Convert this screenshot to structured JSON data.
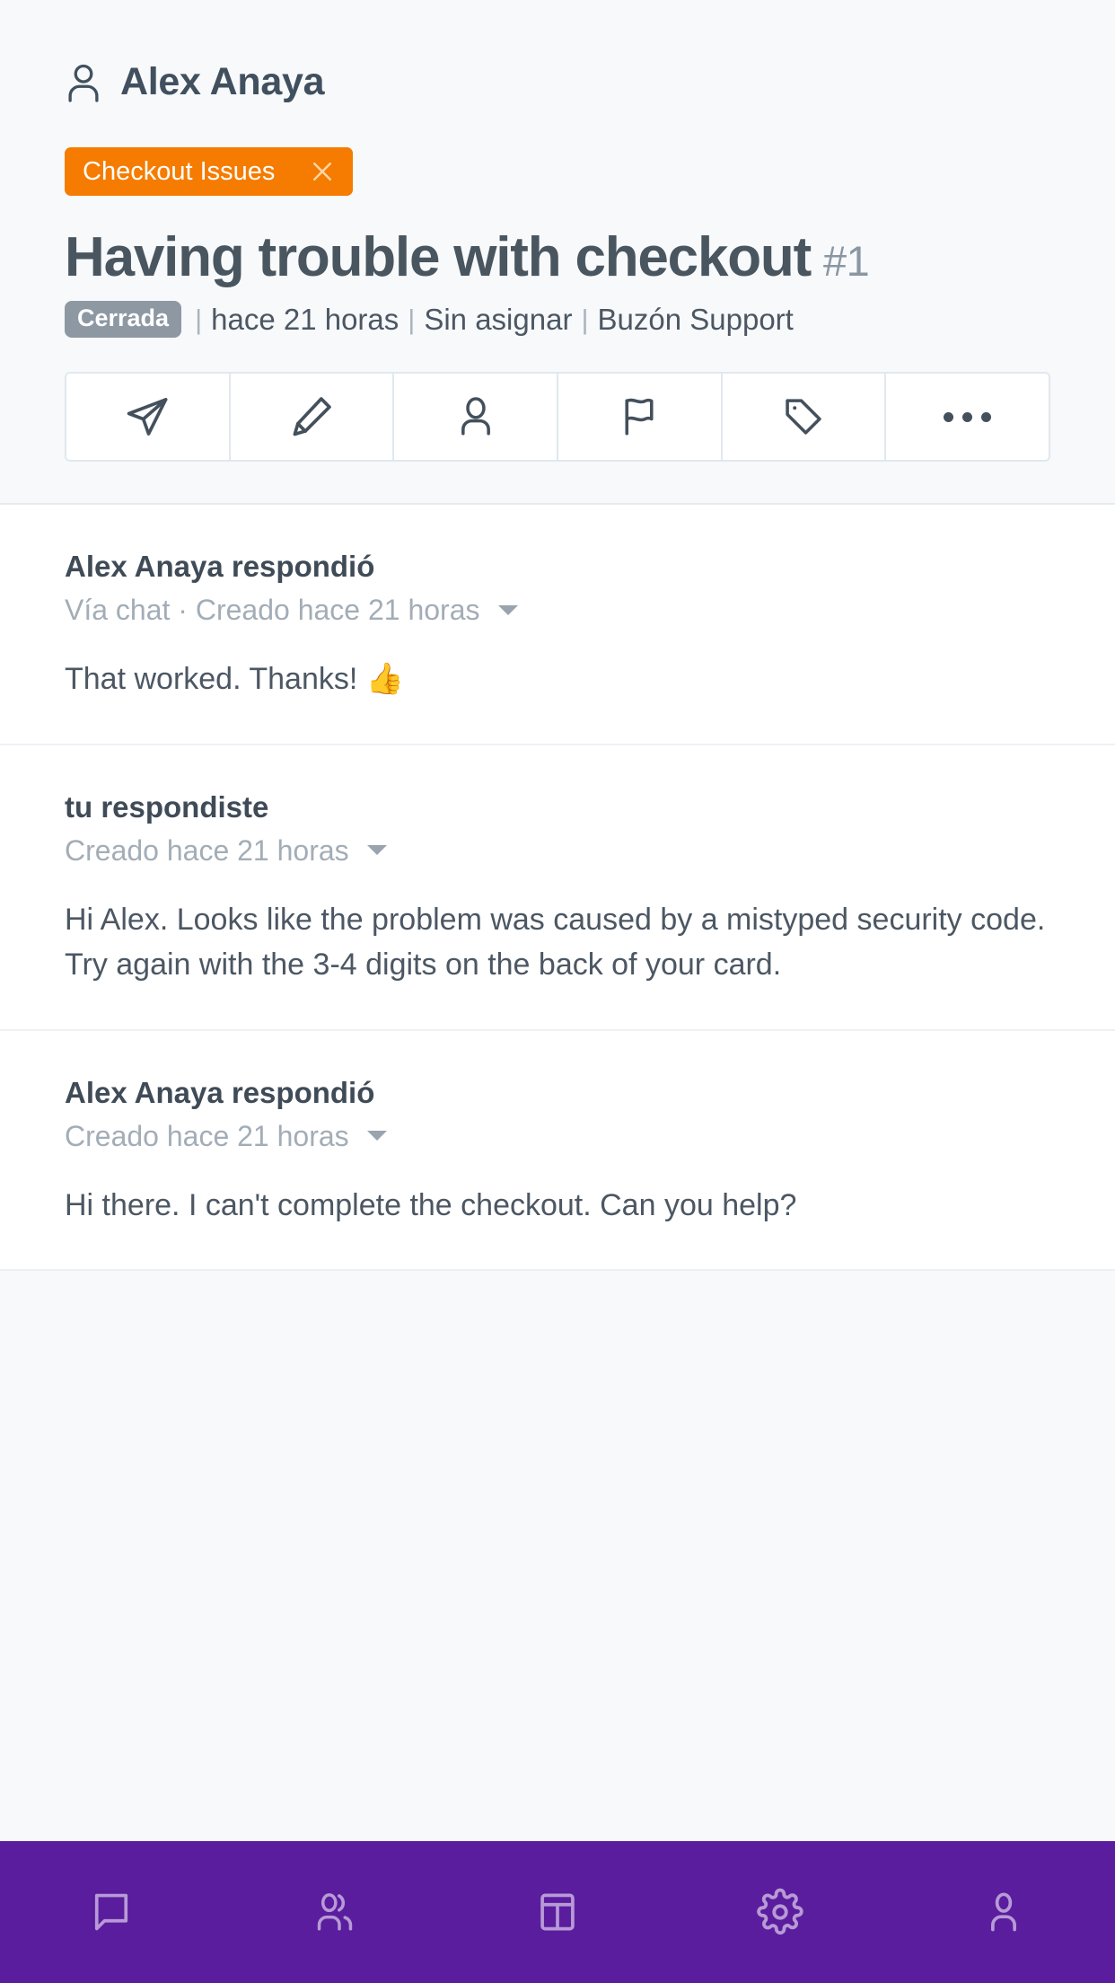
{
  "header": {
    "customer": {
      "name": "Alex Anaya",
      "icon": "person-icon"
    },
    "tag": {
      "label": "Checkout Issues",
      "color": "#f57c00",
      "close_icon": "close-icon"
    },
    "title": "Having trouble with checkout",
    "ticket_number": "#1",
    "meta": {
      "status": "Cerrada",
      "status_color": "#8d98a3",
      "separator": "|",
      "created": "hace 21 horas",
      "assignee": "Sin asignar",
      "mailbox": "Buzón Support"
    },
    "toolbar": [
      {
        "name": "reply-button",
        "icon": "send-icon"
      },
      {
        "name": "note-button",
        "icon": "pencil-icon"
      },
      {
        "name": "assign-button",
        "icon": "person-icon"
      },
      {
        "name": "status-button",
        "icon": "flag-icon"
      },
      {
        "name": "tag-button",
        "icon": "tag-icon"
      },
      {
        "name": "more-button",
        "icon": "ellipsis-icon"
      }
    ]
  },
  "thread": [
    {
      "author": "Alex Anaya respondió",
      "meta": "Vía chat · Creado hace 21 horas",
      "body": "That worked. Thanks! 👍"
    },
    {
      "author": "tu respondiste",
      "meta": "Creado hace 21 horas",
      "body": "Hi Alex. Looks like the problem was caused by a mistyped security code. Try again with the 3-4 digits on the back of your card."
    },
    {
      "author": "Alex Anaya respondió",
      "meta": "Creado hace 21 horas",
      "body": "Hi there. I can't complete the checkout. Can you help?"
    }
  ],
  "bottom_nav": {
    "background": "#5a1d9e",
    "items": [
      {
        "name": "nav-conversations",
        "icon": "chat-bubble-icon"
      },
      {
        "name": "nav-customers",
        "icon": "people-icon"
      },
      {
        "name": "nav-dashboard",
        "icon": "layout-panel-icon"
      },
      {
        "name": "nav-settings",
        "icon": "gear-icon"
      },
      {
        "name": "nav-profile",
        "icon": "person-icon"
      }
    ]
  }
}
